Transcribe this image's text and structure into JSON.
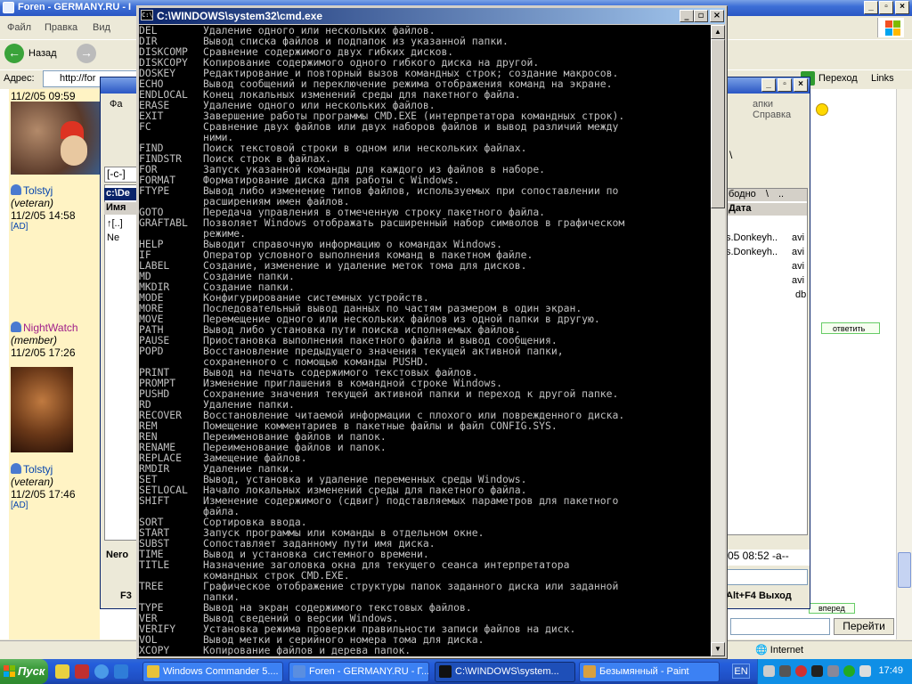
{
  "ie": {
    "title": "Foren - GERMANY.RU - I",
    "menu": [
      "Файл",
      "Правка",
      "Вид",
      "Избранное"
    ],
    "back_label": "Назад",
    "address_label": "Адрес:",
    "address_value": "http://for",
    "go_label": "Переход",
    "links_label": "Links",
    "zone_label": "Internet",
    "goto_button": "Перейти"
  },
  "forum": {
    "posts": [
      {
        "name": "",
        "rank": "",
        "time": "11/2/05 09:59",
        "ad": ""
      },
      {
        "name": "Tolstyj",
        "rank": "(veteran)",
        "time": "11/2/05 14:58",
        "ad": "[AD]"
      },
      {
        "name": "NightWatch",
        "rank": "(member)",
        "time": "11/2/05 17:26",
        "ad": ""
      },
      {
        "name": "Tolstyj",
        "rank": "(veteran)",
        "time": "11/2/05 17:46",
        "ad": "[AD]"
      }
    ],
    "reply_label": "ответить",
    "forward_label": "вперед",
    "list_label": "список"
  },
  "wc": {
    "menu": "Фа",
    "help": "апки  Справка",
    "drive": "[-c-]",
    "path": "c:\\De",
    "col_name": "Имя",
    "left_rows": [
      "↑[..]",
      "Ne"
    ],
    "right_sel": "бодно",
    "right_sep": "\\",
    "right_dots": "..",
    "right_col": "Дата",
    "right_rows": [
      {
        "name": "s.Donkeyh..",
        "ext": "avi"
      },
      {
        "name": "s.Donkeyh..",
        "ext": "avi"
      },
      {
        "name": "",
        "ext": "avi"
      },
      {
        "name": "",
        "ext": "avi"
      },
      {
        "name": "",
        "ext": "db"
      }
    ],
    "path_right": "\\",
    "cmdline": "05 08:52 -a--",
    "nero": "Nero",
    "f3": "F3",
    "fkeys": "Alt+F4 Выход"
  },
  "cmd": {
    "title": "C:\\WINDOWS\\system32\\cmd.exe",
    "lines": [
      [
        "DEL",
        "Удаление одного или нескольких файлов."
      ],
      [
        "DIR",
        "Вывод списка файлов и подпапок из указанной папки."
      ],
      [
        "DISKCOMP",
        "Сравнение содержимого двух гибких дисков."
      ],
      [
        "DISKCOPY",
        "Копирование содержимого одного гибкого диска на другой."
      ],
      [
        "DOSKEY",
        "Редактирование и повторный вызов командных строк; создание макросов."
      ],
      [
        "ECHO",
        "Вывод сообщений и переключение режима отображения команд на экране."
      ],
      [
        "ENDLOCAL",
        "Конец локальных изменений среды для пакетного файла."
      ],
      [
        "ERASE",
        "Удаление одного или нескольких файлов."
      ],
      [
        "EXIT",
        "Завершение работы программы CMD.EXE (интерпретатора командных строк)."
      ],
      [
        "FC",
        "Сравнение двух файлов или двух наборов файлов и вывод различий между"
      ],
      [
        "",
        "ними."
      ],
      [
        "FIND",
        "Поиск текстовой строки в одном или нескольких файлах."
      ],
      [
        "FINDSTR",
        "Поиск строк в файлах."
      ],
      [
        "FOR",
        "Запуск указанной команды для каждого из файлов в наборе."
      ],
      [
        "FORMAT",
        "Форматирование диска для работы с Windows."
      ],
      [
        "FTYPE",
        "Вывод либо изменение типов файлов, используемых при сопоставлении по"
      ],
      [
        "",
        "расширениям имен файлов."
      ],
      [
        "GOTO",
        "Передача управления в отмеченную строку пакетного файла."
      ],
      [
        "GRAFTABL",
        "Позволяет Windows отображать расширенный набор символов в графическом"
      ],
      [
        "",
        "режиме."
      ],
      [
        "HELP",
        "Выводит справочную информацию о командах Windows."
      ],
      [
        "IF",
        "Оператор условного выполнения команд в пакетном файле."
      ],
      [
        "LABEL",
        "Создание, изменение и удаление меток тома для дисков."
      ],
      [
        "MD",
        "Создание папки."
      ],
      [
        "MKDIR",
        "Создание папки."
      ],
      [
        "MODE",
        "Конфигурирование системных устройств."
      ],
      [
        "MORE",
        "Последовательный вывод данных по частям размером в один экран."
      ],
      [
        "MOVE",
        "Перемещение одного или нескольких файлов из одной папки в другую."
      ],
      [
        "PATH",
        "Вывод либо установка пути поиска исполняемых файлов."
      ],
      [
        "PAUSE",
        "Приостановка выполнения пакетного файла и вывод сообщения."
      ],
      [
        "POPD",
        "Восстановление предыдущего значения текущей активной папки,"
      ],
      [
        "",
        "сохраненного с помощью команды PUSHD."
      ],
      [
        "PRINT",
        "Вывод на печать содержимого текстовых файлов."
      ],
      [
        "PROMPT",
        "Изменение приглашения в командной строке Windows."
      ],
      [
        "PUSHD",
        "Сохранение значения текущей активной папки и переход к другой папке."
      ],
      [
        "RD",
        "Удаление папки."
      ],
      [
        "RECOVER",
        "Восстановление читаемой информации с плохого или поврежденного диска."
      ],
      [
        "REM",
        "Помещение комментариев в пакетные файлы и файл CONFIG.SYS."
      ],
      [
        "REN",
        "Переименование файлов и папок."
      ],
      [
        "RENAME",
        "Переименование файлов и папок."
      ],
      [
        "REPLACE",
        "Замещение файлов."
      ],
      [
        "RMDIR",
        "Удаление папки."
      ],
      [
        "SET",
        "Вывод, установка и удаление переменных среды Windows."
      ],
      [
        "SETLOCAL",
        "Начало локальных изменений среды для пакетного файла."
      ],
      [
        "SHIFT",
        "Изменение содержимого (сдвиг) подставляемых параметров для пакетного"
      ],
      [
        "",
        "файла."
      ],
      [
        "SORT",
        "Сортировка ввода."
      ],
      [
        "START",
        "Запуск программы или команды в отдельном окне."
      ],
      [
        "SUBST",
        "Сопоставляет заданному пути имя диска."
      ],
      [
        "TIME",
        "Вывод и установка системного времени."
      ],
      [
        "TITLE",
        "Назначение заголовка окна для текущего сеанса интерпретатора"
      ],
      [
        "",
        "командных строк CMD.EXE."
      ],
      [
        "TREE",
        "Графическое отображение структуры папок заданного диска или заданной"
      ],
      [
        "",
        "папки."
      ],
      [
        "TYPE",
        "Вывод на экран содержимого текстовых файлов."
      ],
      [
        "VER",
        "Вывод сведений о версии Windows."
      ],
      [
        "VERIFY",
        "Установка режима проверки правильности записи файлов на диск."
      ],
      [
        "VOL",
        "Вывод метки и серийного номера тома для диска."
      ],
      [
        "XCOPY",
        "Копирование файлов и дерева папок."
      ]
    ]
  },
  "taskbar": {
    "start_label": "Пуск",
    "tasks": [
      {
        "label": "Windows Commander 5....",
        "icon_color": "#e8c23a",
        "active": false
      },
      {
        "label": "Foren - GERMANY.RU - Г...",
        "icon_color": "#5a8ee0",
        "active": false
      },
      {
        "label": "C:\\WINDOWS\\system...",
        "icon_color": "#111111",
        "active": true
      },
      {
        "label": "Безымянный - Paint",
        "icon_color": "#d8a040",
        "active": false
      }
    ],
    "lang": "EN",
    "clock": "17:49"
  }
}
